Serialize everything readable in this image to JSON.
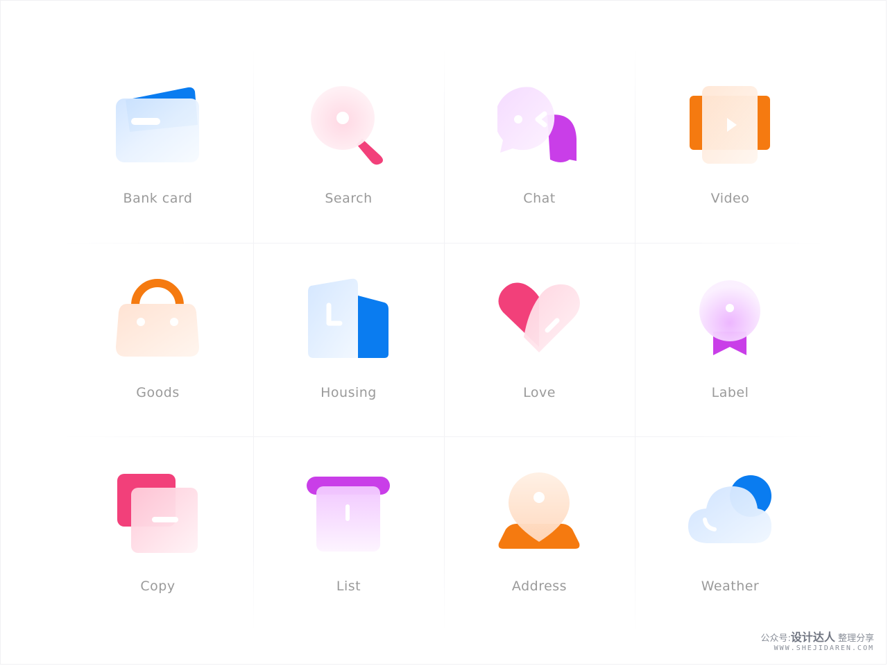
{
  "icons": [
    {
      "label": "Bank card",
      "icon": "bank-card-icon"
    },
    {
      "label": "Search",
      "icon": "search-icon"
    },
    {
      "label": "Chat",
      "icon": "chat-icon"
    },
    {
      "label": "Video",
      "icon": "video-icon"
    },
    {
      "label": "Goods",
      "icon": "goods-bag-icon"
    },
    {
      "label": "Housing",
      "icon": "housing-icon"
    },
    {
      "label": "Love",
      "icon": "heart-icon"
    },
    {
      "label": "Label",
      "icon": "badge-label-icon"
    },
    {
      "label": "Copy",
      "icon": "copy-icon"
    },
    {
      "label": "List",
      "icon": "list-icon"
    },
    {
      "label": "Address",
      "icon": "map-pin-icon"
    },
    {
      "label": "Weather",
      "icon": "weather-cloud-icon"
    }
  ],
  "watermark": {
    "prefix": "公众号:",
    "brand": "设计达人",
    "suffix": "整理分享",
    "url": "WWW.SHEJIDAREN.COM"
  },
  "colors": {
    "blue": "#0a7cf0",
    "pink": "#f2407a",
    "purple": "#c93ee8",
    "orange": "#f57a10",
    "label_gray": "#9a9a9a"
  }
}
